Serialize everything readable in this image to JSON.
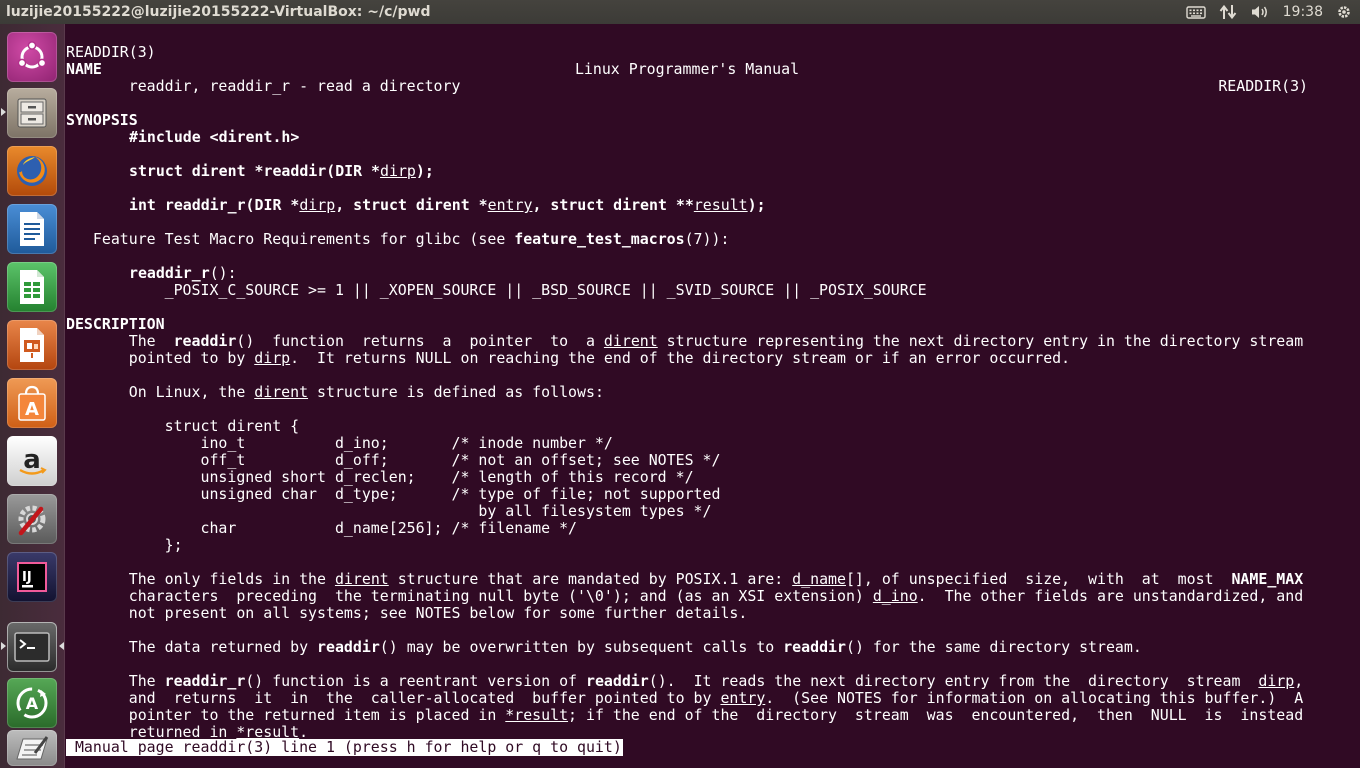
{
  "window": {
    "title": "luzijie20155222@luzijie20155222-VirtualBox: ~/c/pwd"
  },
  "tray": {
    "time": "19:38",
    "icons": [
      "keyboard-icon",
      "network-updown-icon",
      "volume-icon",
      "gear-icon"
    ]
  },
  "launcher": {
    "items": [
      {
        "name": "ubuntu-dash",
        "icon": "ubuntu-logo-icon",
        "color": "#b3328c"
      },
      {
        "name": "files",
        "icon": "file-cabinet-icon",
        "color": "#9a8f80"
      },
      {
        "name": "firefox",
        "icon": "firefox-icon",
        "color": "#e66000"
      },
      {
        "name": "libreoffice-writer",
        "icon": "writer-document-icon",
        "color": "#2a6bb0"
      },
      {
        "name": "libreoffice-calc",
        "icon": "calc-spreadsheet-icon",
        "color": "#2f9a3a"
      },
      {
        "name": "libreoffice-impress",
        "icon": "impress-presentation-icon",
        "color": "#d05a1f"
      },
      {
        "name": "ubuntu-software-center",
        "icon": "shopping-bag-icon",
        "color": "#e9762c"
      },
      {
        "name": "amazon",
        "icon": "amazon-icon",
        "color": "#f2f2f2"
      },
      {
        "name": "system-settings",
        "icon": "settings-wrench-icon",
        "color": "#7a7a7a"
      },
      {
        "name": "intellij-idea",
        "icon": "intellij-icon",
        "color": "#1b1b3a"
      },
      {
        "name": "terminal",
        "icon": "terminal-icon",
        "color": "#2c2c2c"
      },
      {
        "name": "software-updater",
        "icon": "software-updater-icon",
        "color": "#3d8a3d"
      },
      {
        "name": "text-editor",
        "icon": "text-editor-icon",
        "color": "#9a9a9a"
      }
    ]
  },
  "man": {
    "header": {
      "left": "READDIR(3)",
      "center": "Linux Programmer's Manual",
      "right": "READDIR(3)"
    },
    "name_heading": "NAME",
    "name_line": "       readdir, readdir_r - read a directory",
    "synopsis_heading": "SYNOPSIS",
    "include": "#include <dirent.h>",
    "proto1": {
      "a": "struct dirent *readdir(DIR *",
      "arg": "dirp",
      "b": ");"
    },
    "proto2": {
      "a": "int readdir_r(DIR *",
      "arg1": "dirp",
      "b": ", struct dirent *",
      "arg2": "entry",
      "c": ", struct dirent **",
      "arg3": "result",
      "d": ");"
    },
    "ftm": {
      "pre": "   Feature Test Macro Requirements for glibc (see ",
      "fn": "feature_test_macros",
      "post": "(7)):"
    },
    "ftm_fn": "readdir_r",
    "ftm_fn_post": "():",
    "ftm_cond": "           _POSIX_C_SOURCE >= 1 || _XOPEN_SOURCE || _BSD_SOURCE || _SVID_SOURCE || _POSIX_SOURCE",
    "description_heading": "DESCRIPTION",
    "d1": {
      "a": "       The  ",
      "fn": "readdir",
      "b": "()  function  returns  a  pointer  to  a ",
      "u": "dirent",
      "c": " structure representing the next directory entry in the directory stream"
    },
    "d2": {
      "a": "       pointed to by ",
      "u": "dirp",
      "b": ".  It returns NULL on reaching the end of the directory stream or if an error occurred."
    },
    "d3": {
      "a": "       On Linux, the ",
      "u": "dirent",
      "b": " structure is defined as follows:"
    },
    "struct_lines": [
      "           struct dirent {",
      "               ino_t          d_ino;       /* inode number */",
      "               off_t          d_off;       /* not an offset; see NOTES */",
      "               unsigned short d_reclen;    /* length of this record */",
      "               unsigned char  d_type;      /* type of file; not supported",
      "                                              by all filesystem types */",
      "               char           d_name[256]; /* filename */",
      "           };"
    ],
    "p1": {
      "a": "       The only fields in the ",
      "u1": "dirent",
      "b": " structure that are mandated by POSIX.1 are: ",
      "u2": "d_name",
      "c": "[], of unspecified  size,  with  at  most  ",
      "bold": "NAME_MAX"
    },
    "p2": {
      "a": "       characters  preceding  the terminating null byte ('\\0'); and (as an XSI extension) ",
      "u": "d_ino",
      "b": ".  The other fields are unstandardized, and"
    },
    "p3": "       not present on all systems; see NOTES below for some further details.",
    "p4": {
      "a": "       The data returned by ",
      "f1": "readdir",
      "b": "() may be overwritten by subsequent calls to ",
      "f2": "readdir",
      "c": "() for the same directory stream."
    },
    "p5": {
      "a": "       The ",
      "f1": "readdir_r",
      "b": "() function is a reentrant version of ",
      "f2": "readdir",
      "c": "().  It reads the next directory entry from the  directory  stream  ",
      "u": "dirp",
      "d": ","
    },
    "p6": {
      "a": "       and  returns  it  in  the  caller-allocated  buffer pointed to by ",
      "u": "entry",
      "b": ".  (See NOTES for information on allocating this buffer.)  A"
    },
    "p7": {
      "a": "       pointer to the returned item is placed in ",
      "u": "*result",
      "b": "; if the end of the  directory  stream  was  encountered,  then  NULL  is  instead"
    },
    "p8": {
      "a": "       returned in ",
      "u": "*result",
      "b": "."
    },
    "status": " Manual page readdir(3) line 1 (press h for help or q to quit)"
  }
}
